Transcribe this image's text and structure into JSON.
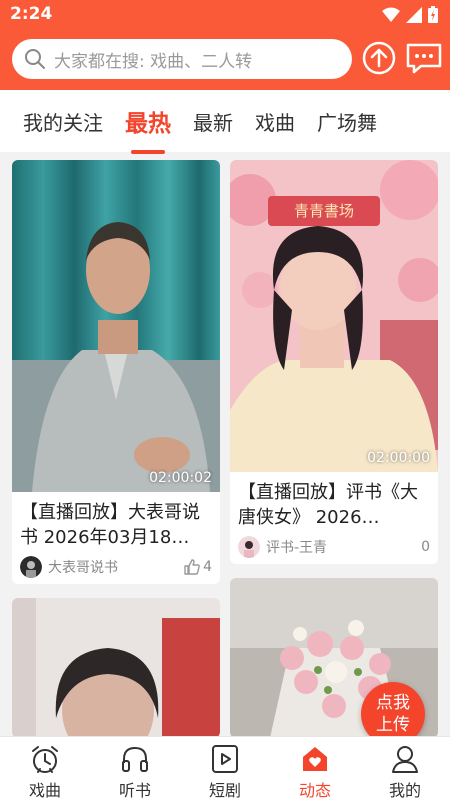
{
  "status": {
    "time": "2:24"
  },
  "search": {
    "placeholder": "大家都在搜: 戏曲、二人转"
  },
  "tabs": [
    {
      "label": "我的关注"
    },
    {
      "label": "最热"
    },
    {
      "label": "最新"
    },
    {
      "label": "戏曲"
    },
    {
      "label": "广场舞"
    }
  ],
  "active_tab": "最热",
  "cards": [
    {
      "title": "【直播回放】大表哥说书 2026年03月18…",
      "duration": "02:00:02",
      "author": "大表哥说书",
      "likes": "4"
    },
    {
      "title": "【直播回放】评书《大唐侠女》 2026…",
      "duration": "02:00:00",
      "author": "评书-王青",
      "likes": "0",
      "banner_text": "青青書场"
    },
    {
      "title": "",
      "duration": "",
      "author": "",
      "likes": ""
    },
    {
      "title": "",
      "duration": "",
      "author": "",
      "likes": ""
    }
  ],
  "fab": {
    "line1": "点我",
    "line2": "上传"
  },
  "nav": [
    {
      "label": "戏曲",
      "icon": "alarm-clock-icon"
    },
    {
      "label": "听书",
      "icon": "headphones-icon"
    },
    {
      "label": "短剧",
      "icon": "play-box-icon"
    },
    {
      "label": "动态",
      "icon": "heart-home-icon"
    },
    {
      "label": "我的",
      "icon": "person-icon"
    }
  ],
  "active_nav": "动态",
  "colors": {
    "accent": "#fa5a37",
    "active": "#f4452c"
  }
}
